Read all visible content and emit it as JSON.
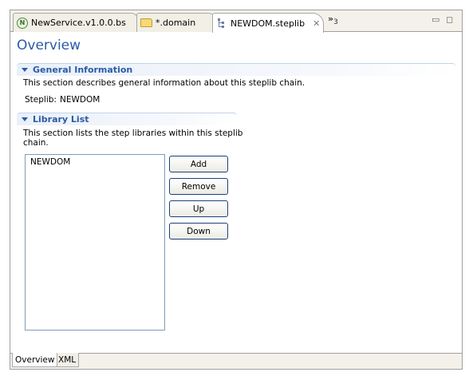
{
  "tabs": [
    {
      "label": "NewService.v1.0.0.bs",
      "icon": "service-n-icon"
    },
    {
      "label": "*.domain",
      "icon": "folder-icon"
    },
    {
      "label": "NEWDOM.steplib",
      "icon": "steplib-tree-icon",
      "close": "✕"
    }
  ],
  "tab_overflow": {
    "chevron": "»",
    "count": "3"
  },
  "window_controls": {
    "minimize": "▭",
    "maximize": "◻"
  },
  "page": {
    "title": "Overview"
  },
  "general": {
    "title": "General Information",
    "description": "This section describes general information about this steplib chain.",
    "steplib_label": "Steplib:",
    "steplib_value": "NEWDOM"
  },
  "library": {
    "title": "Library List",
    "description_line1": "This section lists the step libraries within this steplib",
    "description_line2": "chain.",
    "items": [
      "NEWDOM"
    ],
    "buttons": {
      "add": "Add",
      "remove": "Remove",
      "up": "Up",
      "down": "Down"
    }
  },
  "bottom_tabs": [
    {
      "label": "Overview",
      "active": true
    },
    {
      "label": "XML",
      "active": false
    }
  ],
  "colors": {
    "accent": "#2a5ca6",
    "section_border": "#c3d3ea"
  }
}
